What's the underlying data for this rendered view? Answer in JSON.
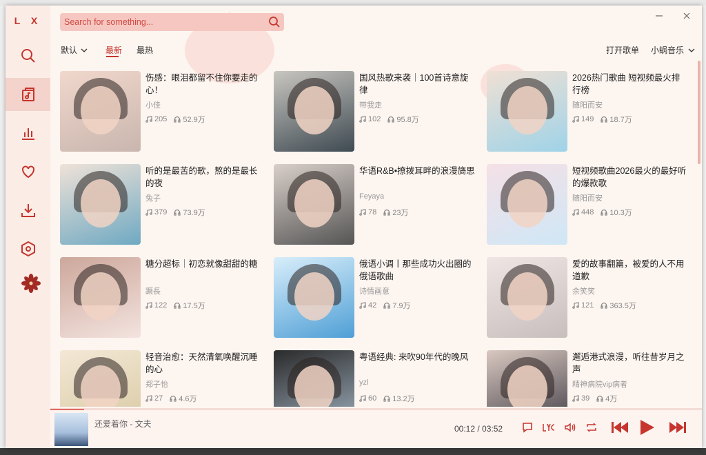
{
  "app": {
    "logo": "L X"
  },
  "colors": {
    "accent": "#c6362e",
    "background": "#fdf5f0",
    "sidebar": "#fbece6",
    "search_bg": "#f6c7c1"
  },
  "sidebar": {
    "items": [
      {
        "icon": "search-icon"
      },
      {
        "icon": "song-list-icon"
      },
      {
        "icon": "leaderboard-icon"
      },
      {
        "icon": "heart-icon"
      },
      {
        "icon": "download-icon"
      },
      {
        "icon": "settings-icon"
      }
    ],
    "active_index": 1
  },
  "search": {
    "placeholder": "Search for something..."
  },
  "sort": {
    "default": "默认",
    "latest": "最新",
    "hottest": "最热",
    "active": "最新"
  },
  "header": {
    "open_list": "打开歌单",
    "source": "小蜗音乐"
  },
  "playlists": [
    {
      "title": "伤感：眼泪都留不住你要走的心！",
      "author": "小佳",
      "songs": "205",
      "plays": "52.9万"
    },
    {
      "title": "国风热歌来袭｜100首诗意旋律",
      "author": "带我走",
      "songs": "102",
      "plays": "95.8万"
    },
    {
      "title": "2026热门歌曲 短视频最火排行榜",
      "author": "随阳而安",
      "songs": "149",
      "plays": "18.7万"
    },
    {
      "title": "听的是最苦的歌，熬的是最长的夜",
      "author": "兔子",
      "songs": "379",
      "plays": "73.9万"
    },
    {
      "title": "华语R&B•撩拨耳畔的浪漫旖思",
      "author": "Feyaya",
      "songs": "78",
      "plays": "23万"
    },
    {
      "title": "短视频歌曲2026最火的最好听的爆款歌",
      "author": "随阳而安",
      "songs": "448",
      "plays": "10.3万"
    },
    {
      "title": "糖分超标｜初恋就像甜甜的糖",
      "author": "蹶長",
      "songs": "122",
      "plays": "17.5万"
    },
    {
      "title": "俄语小调丨那些成功火出圈的俄语歌曲",
      "author": "诗情画意",
      "songs": "42",
      "plays": "7.9万"
    },
    {
      "title": "爱的故事翻篇，被爱的人不用道歉",
      "author": "余笑笑",
      "songs": "121",
      "plays": "363.5万"
    },
    {
      "title": "轻音治愈：天然清氧唤醒沉睡的心",
      "author": "郑子怡",
      "songs": "27",
      "plays": "4.6万"
    },
    {
      "title": "粤语经典: 来吹90年代的晚风",
      "author": "yzl",
      "songs": "60",
      "plays": "13.2万"
    },
    {
      "title": "邂逅港式浪漫，听往昔岁月之声",
      "author": "精神病院vip病者",
      "songs": "39",
      "plays": "4万"
    }
  ],
  "player": {
    "song": "还爱着你 - 文夫",
    "current_time": "00:12",
    "total_time": "03:52",
    "progress": 0.052
  }
}
